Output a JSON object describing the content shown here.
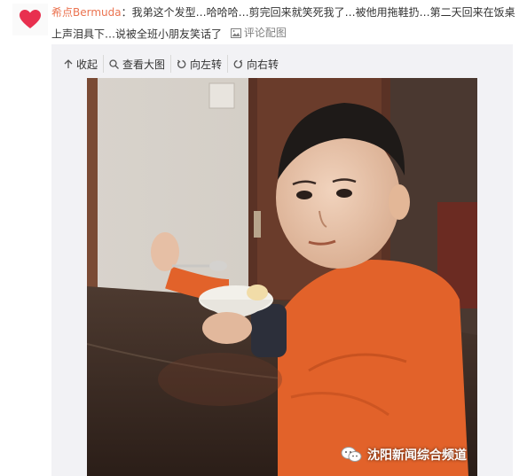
{
  "post": {
    "author": "希点Bermuda",
    "separator": "：",
    "text_line1": "我弟这个发型…哈哈哈…剪完回来就笑死我了…被他用拖鞋扔…第二天回来在饭桌",
    "text_line2": "上声泪具下…说被全班小朋友笑话了",
    "comment_image_label": "评论配图"
  },
  "toolbar": {
    "collapse_label": "收起",
    "view_large_label": "查看大图",
    "rotate_left_label": "向左转",
    "rotate_right_label": "向右转"
  },
  "photo": {
    "watermark": "沈阳新闻综合频道"
  },
  "icons": {
    "avatar": "heart-icon",
    "comment_image": "image-icon",
    "collapse": "arrow-up-icon",
    "view_large": "magnifier-icon",
    "rotate_left": "rotate-left-icon",
    "rotate_right": "rotate-right-icon",
    "watermark": "wechat-icon"
  },
  "colors": {
    "author_link": "#eb7350",
    "heart": "#e8304f",
    "panel_bg": "#f2f2f5",
    "muted_link": "#808080"
  }
}
